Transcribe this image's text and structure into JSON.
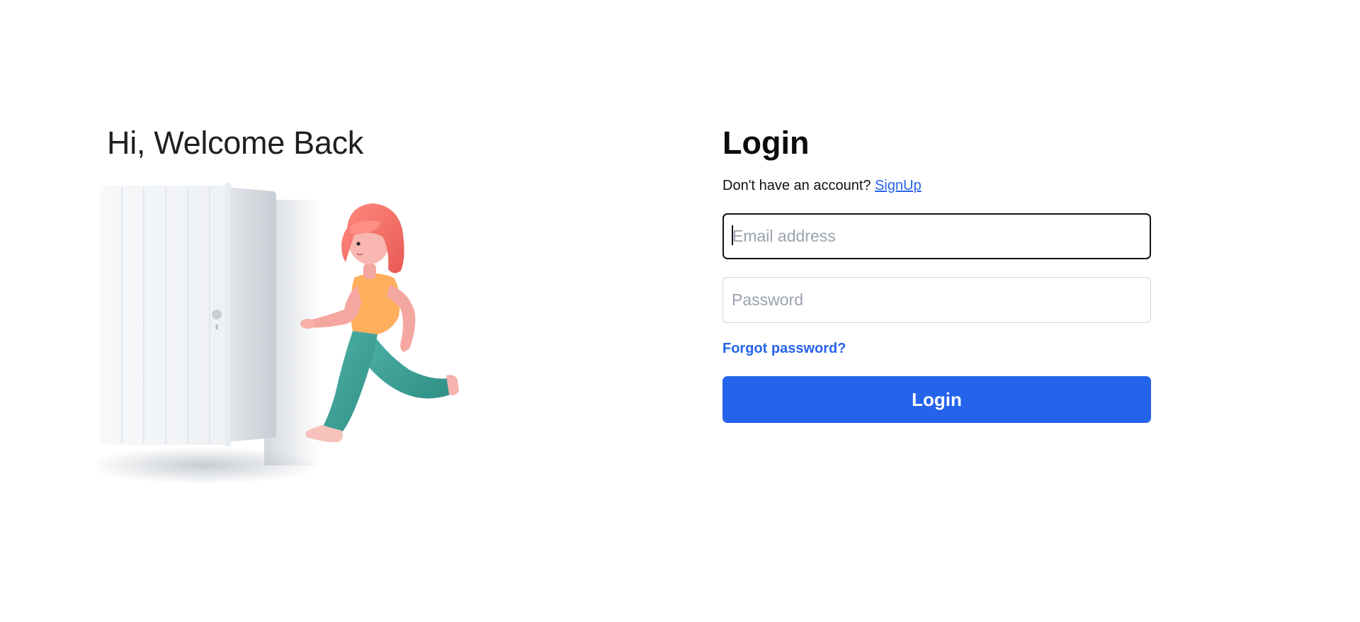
{
  "left_panel": {
    "welcome_title": "Hi, Welcome Back",
    "illustration_name": "door-running-person-illustration"
  },
  "login_form": {
    "title": "Login",
    "signup_prompt": "Don't have an account?",
    "signup_link": "SignUp",
    "email": {
      "placeholder": "Email address",
      "value": ""
    },
    "password": {
      "placeholder": "Password",
      "value": ""
    },
    "forgot_password": "Forgot password?",
    "submit_label": "Login"
  },
  "colors": {
    "accent": "#2563eb",
    "text": "#111111",
    "background": "#ffffff"
  }
}
